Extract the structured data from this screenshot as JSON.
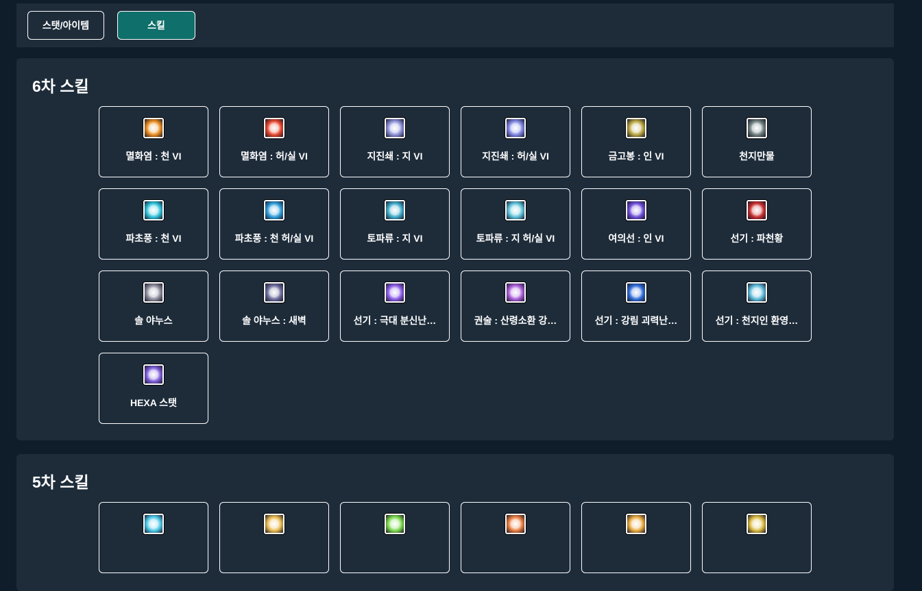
{
  "tabs": [
    {
      "label": "스탯/아이템",
      "active": false
    },
    {
      "label": "스킬",
      "active": true
    }
  ],
  "sections": {
    "sixth": {
      "title": "6차 스킬",
      "skills": [
        {
          "label": "멸화염 : 천 VI",
          "icon": "flame-burst-icon",
          "color": "#e88a1a"
        },
        {
          "label": "멸화염 : 허/실 VI",
          "icon": "flame-burst-alt-icon",
          "color": "#e8442a"
        },
        {
          "label": "지진쇄 : 지 VI",
          "icon": "earthquake-chain-icon",
          "color": "#8a8ed8"
        },
        {
          "label": "지진쇄 : 허/실 VI",
          "icon": "earthquake-chain-alt-icon",
          "color": "#7a82e0"
        },
        {
          "label": "금고봉 : 인 VI",
          "icon": "golden-staff-icon",
          "color": "#b6a23a"
        },
        {
          "label": "천지만물",
          "icon": "heaven-earth-icon",
          "color": "#6a7a7a"
        },
        {
          "label": "파초풍 : 천 VI",
          "icon": "wind-blade-icon",
          "color": "#2ac0d8"
        },
        {
          "label": "파초풍 : 천 허/실 VI",
          "icon": "wind-blade-alt-icon",
          "color": "#2a9ad8"
        },
        {
          "label": "토파류 : 지 VI",
          "icon": "earth-wave-icon",
          "color": "#3aa8c8"
        },
        {
          "label": "토파류 : 지 허/실 VI",
          "icon": "earth-wave-alt-icon",
          "color": "#5ac0d8"
        },
        {
          "label": "여의선 : 인 VI",
          "icon": "ruyi-fan-icon",
          "color": "#6a4ad8"
        },
        {
          "label": "선기 : 파천황",
          "icon": "sky-breaker-icon",
          "color": "#c82a2a"
        },
        {
          "label": "솔 야누스",
          "icon": "sol-janus-icon",
          "color": "#8a8a9a"
        },
        {
          "label": "솔 야누스 : 새벽",
          "icon": "sol-janus-dawn-icon",
          "color": "#6a6a9a"
        },
        {
          "label": "선기 : 극대 분신난…",
          "icon": "clone-chaos-icon",
          "color": "#8a5ae8"
        },
        {
          "label": "권술 : 산령소환 강…",
          "icon": "mountain-spirit-icon",
          "color": "#a85ad8"
        },
        {
          "label": "선기 : 강림 괴력난…",
          "icon": "descent-strength-icon",
          "color": "#2a6ad8"
        },
        {
          "label": "선기 : 천지인 환영…",
          "icon": "heaven-earth-human-icon",
          "color": "#5ab8d8"
        },
        {
          "label": "HEXA 스탯",
          "icon": "hexa-stat-icon",
          "color": "#7a5ad8"
        }
      ]
    },
    "fifth": {
      "title": "5차 스킬",
      "skills": [
        {
          "label": "",
          "icon": "fifth-skill-1-icon",
          "color": "#4ac8e8"
        },
        {
          "label": "",
          "icon": "fifth-skill-2-icon",
          "color": "#e8b84a"
        },
        {
          "label": "",
          "icon": "fifth-skill-3-icon",
          "color": "#7ad84a"
        },
        {
          "label": "",
          "icon": "fifth-skill-4-icon",
          "color": "#e87a3a"
        },
        {
          "label": "",
          "icon": "fifth-skill-5-icon",
          "color": "#e8a83a"
        },
        {
          "label": "",
          "icon": "fifth-skill-6-icon",
          "color": "#d8b83a"
        }
      ]
    }
  }
}
